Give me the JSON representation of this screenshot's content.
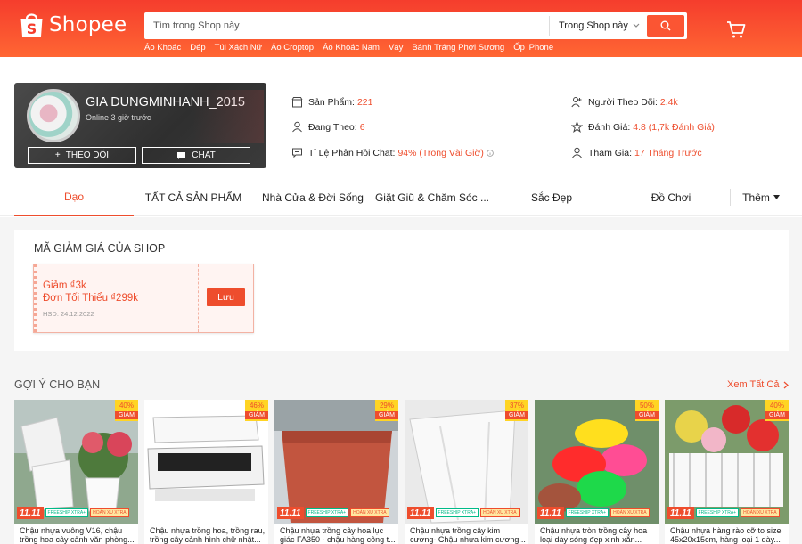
{
  "header": {
    "logo_text": "Shopee",
    "search_placeholder": "Tìm trong Shop này",
    "search_scope": "Trong Shop này",
    "quick_links": [
      "Áo Khoác",
      "Dép",
      "Túi Xách Nữ",
      "Áo Croptop",
      "Áo Khoác Nam",
      "Váy",
      "Bánh Tráng Phơi Sương",
      "Ốp iPhone"
    ]
  },
  "shop": {
    "name": "GIA DUNGMINHANH_2015",
    "online": "Online 3 giờ trước",
    "follow_label": "THEO DÕI",
    "chat_label": "CHAT",
    "stats": {
      "products_label": "Sản Phẩm:",
      "products_value": "221",
      "following_label": "Đang Theo:",
      "following_value": "6",
      "response_label": "Tỉ Lệ Phản Hồi Chat:",
      "response_value": "94% (Trong Vài Giờ)",
      "followers_label": "Người Theo Dõi:",
      "followers_value": "2.4k",
      "rating_label": "Đánh Giá:",
      "rating_value": "4.8 (1,7k Đánh Giá)",
      "joined_label": "Tham Gia:",
      "joined_value": "17 Tháng Trước"
    }
  },
  "nav": {
    "items": [
      "Dạo",
      "TẤT CẢ SẢN PHẨM",
      "Nhà Cửa & Đời Sống",
      "Giặt Giũ & Chăm Sóc ...",
      "Sắc Đẹp",
      "Đồ Chơi"
    ],
    "more": "Thêm"
  },
  "vouchers": {
    "title": "MÃ GIẢM GIÁ CỦA SHOP",
    "items": [
      {
        "amount": "Giảm ₫3k",
        "min": "Đơn Tối Thiểu ₫299k",
        "expiry": "HSD: 24.12.2022",
        "save_label": "Lưu"
      }
    ]
  },
  "recommend": {
    "title": "GỢI Ý CHO BẠN",
    "see_all": "Xem Tất Cả",
    "badge_sale": "11.11",
    "badge_freeship": "FREESHIP XTRA+",
    "badge_cashback": "HOÀN XU XTRA",
    "discount_word": "GIẢM",
    "products": [
      {
        "discount": "40%",
        "name": "Chậu nhựa vuông V16, chậu trồng hoa cây cảnh văn phòng..."
      },
      {
        "discount": "46%",
        "name": "Chậu nhựa trồng hoa, trồng rau, trồng cây cảnh hình chữ nhật..."
      },
      {
        "discount": "29%",
        "name": "Chậu nhựa trồng cây hoa lục giác FA350 - chậu hàng công t..."
      },
      {
        "discount": "37%",
        "name": "Chậu nhựa trồng cây kim cương- Chậu nhựa kim cương..."
      },
      {
        "discount": "50%",
        "name": "Chậu nhựa tròn trồng cây hoa loại dày sóng đẹp xinh xắn..."
      },
      {
        "discount": "40%",
        "name": "Chậu nhựa hàng rào cỡ to size 45x20x15cm, hàng loại 1 dày..."
      }
    ]
  },
  "colors": {
    "primary": "#ee4d2d",
    "header_top": "#f53d2d",
    "header_bottom": "#ff6633"
  }
}
